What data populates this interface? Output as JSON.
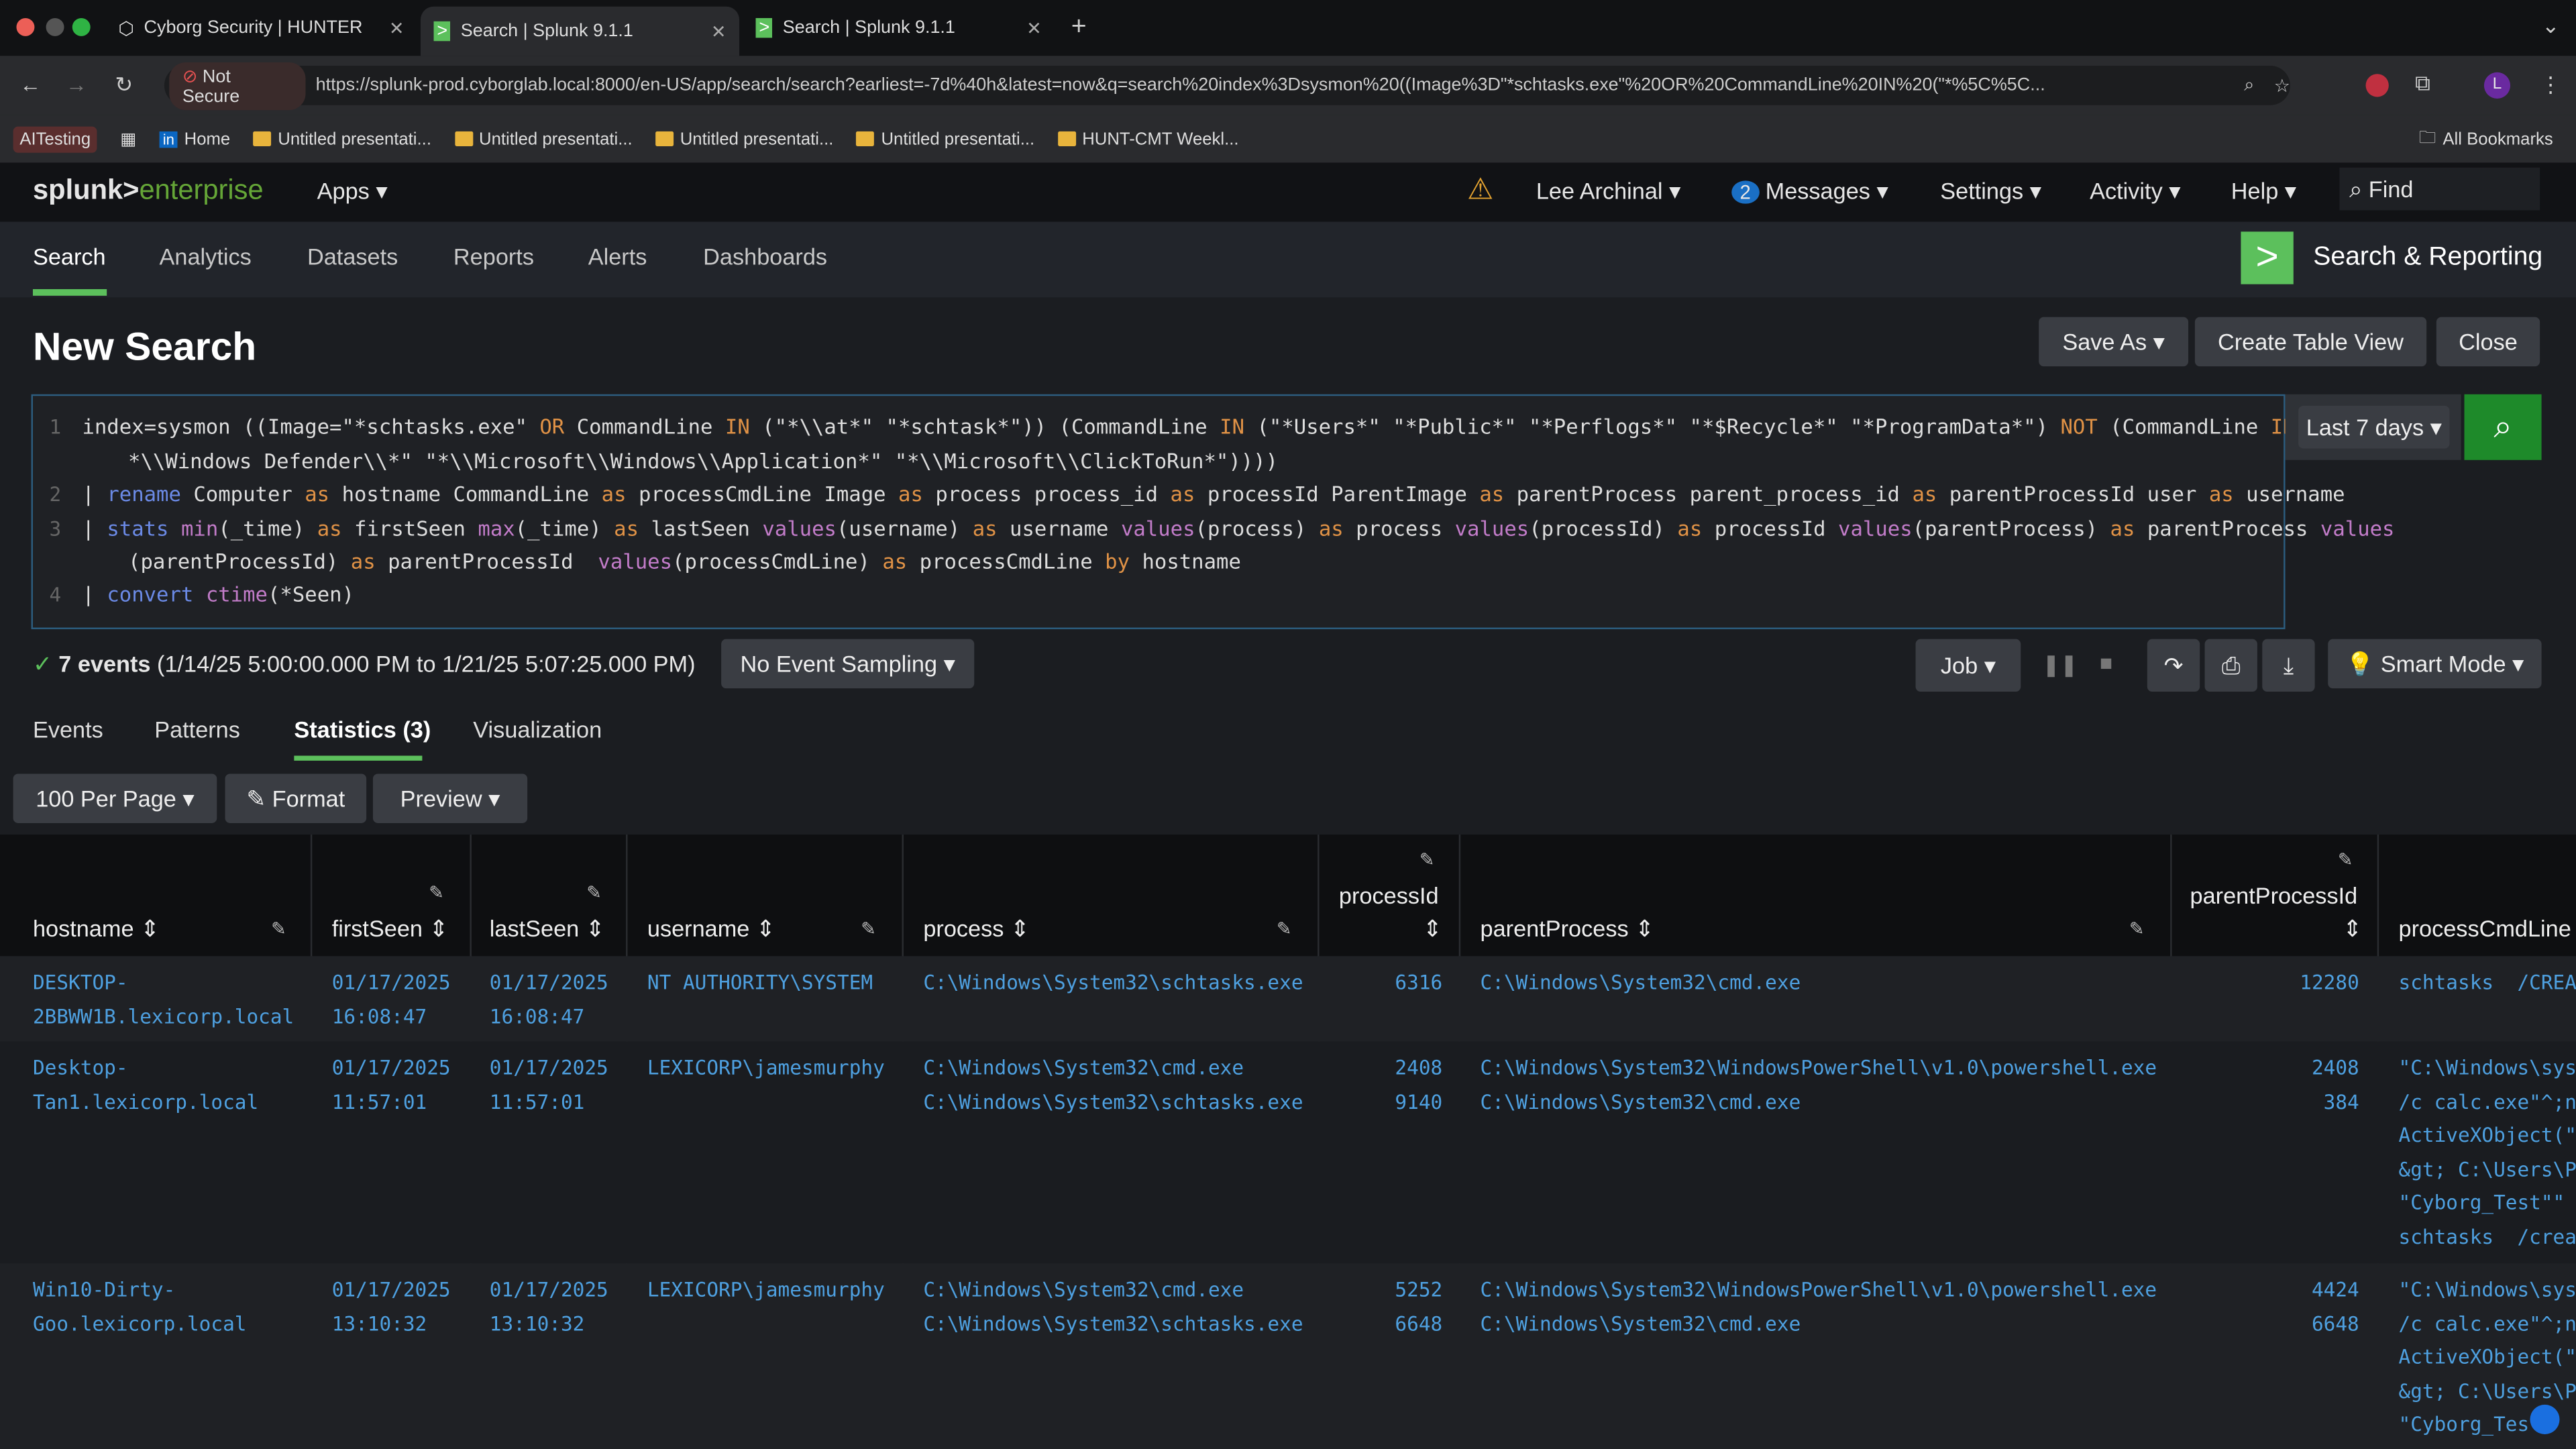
{
  "browser": {
    "tabs": [
      {
        "label": "Cyborg Security | HUNTER"
      },
      {
        "label": "Search | Splunk 9.1.1"
      },
      {
        "label": "Search | Splunk 9.1.1"
      }
    ],
    "not_secure": "Not Secure",
    "url": "https://splunk-prod.cyborglab.local:8000/en-US/app/search/search?earliest=-7d%40h&latest=now&q=search%20index%3Dsysmon%20((Image%3D\"*schtasks.exe\"%20OR%20CommandLine%20IN%20(\"*%5C%5C...",
    "bookmarks": [
      "AITesting",
      "Home",
      "Untitled presentati...",
      "Untitled presentati...",
      "Untitled presentati...",
      "Untitled presentati...",
      "HUNT-CMT Weekl..."
    ],
    "all_bookmarks": "All Bookmarks",
    "profile_initial": "L"
  },
  "splunk": {
    "logo_a": "splunk>",
    "logo_b": "enterprise",
    "apps": "Apps",
    "user": "Lee Archinal",
    "messages_count": "2",
    "messages": "Messages",
    "settings": "Settings",
    "activity": "Activity",
    "help": "Help",
    "find": "Find",
    "nav": [
      "Search",
      "Analytics",
      "Datasets",
      "Reports",
      "Alerts",
      "Dashboards"
    ],
    "app_name": "Search & Reporting",
    "page_title": "New Search",
    "save_as": "Save As",
    "create_table": "Create Table View",
    "close": "Close",
    "time_range": "Last 7 days",
    "query_lines": [
      {
        "n": "1"
      },
      {
        "n": "2"
      },
      {
        "n": "3"
      },
      {
        "n": "4"
      }
    ],
    "status": "7 events",
    "status_range": "(1/14/25 5:00:00.000 PM to 1/21/25 5:07:25.000 PM)",
    "sampling": "No Event Sampling",
    "job": "Job",
    "mode": "Smart Mode",
    "result_tabs": [
      "Events",
      "Patterns",
      "Statistics (3)",
      "Visualization"
    ],
    "per_page": "100 Per Page",
    "format": "Format",
    "preview": "Preview",
    "columns": [
      "hostname",
      "firstSeen",
      "lastSeen",
      "username",
      "process",
      "processId",
      "parentProcess",
      "parentProcessId",
      "processCmdLine"
    ],
    "rows": [
      {
        "hostname": "DESKTOP-\n2BBWW1B.lexicorp.local",
        "firstSeen": "01/17/2025\n16:08:47",
        "lastSeen": "01/17/2025\n16:08:47",
        "username": "NT AUTHORITY\\SYSTEM",
        "process": "C:\\Windows\\System32\\schtasks.exe",
        "processId": "6316",
        "parentProcess": "C:\\Windows\\System32\\cmd.exe",
        "parentProcessId": "12280",
        "processCmdLine": "schtasks  /CREA"
      },
      {
        "hostname": "Desktop-\nTan1.lexicorp.local",
        "firstSeen": "01/17/2025\n11:57:01",
        "lastSeen": "01/17/2025\n11:57:01",
        "username": "LEXICORP\\jamesmurphy",
        "process": "C:\\Windows\\System32\\cmd.exe\nC:\\Windows\\System32\\schtasks.exe",
        "processId": "2408\n9140",
        "parentProcess": "C:\\Windows\\System32\\WindowsPowerShell\\v1.0\\powershell.exe\nC:\\Windows\\System32\\cmd.exe",
        "parentProcessId": "2408\n384",
        "processCmdLine": "\"C:\\Windows\\sys\n/c calc.exe\"^;n\nActiveXObject(\"\n&gt; C:\\Users\\P\n\"Cyborg_Test\"\"\nschtasks  /crea"
      },
      {
        "hostname": "Win10-Dirty-\nGoo.lexicorp.local",
        "firstSeen": "01/17/2025\n13:10:32",
        "lastSeen": "01/17/2025\n13:10:32",
        "username": "LEXICORP\\jamesmurphy",
        "process": "C:\\Windows\\System32\\cmd.exe\nC:\\Windows\\System32\\schtasks.exe",
        "processId": "5252\n6648",
        "parentProcess": "C:\\Windows\\System32\\WindowsPowerShell\\v1.0\\powershell.exe\nC:\\Windows\\System32\\cmd.exe",
        "parentProcessId": "4424\n6648",
        "processCmdLine": "\"C:\\Windows\\sys\n/c calc.exe\"^;n\nActiveXObject(\"\n&gt; C:\\Users\\P\n\"Cyborg_Tes"
      }
    ]
  },
  "colors": {
    "accent": "#5cc05c",
    "link": "#4ea0e0",
    "keyword": "#e09246"
  }
}
